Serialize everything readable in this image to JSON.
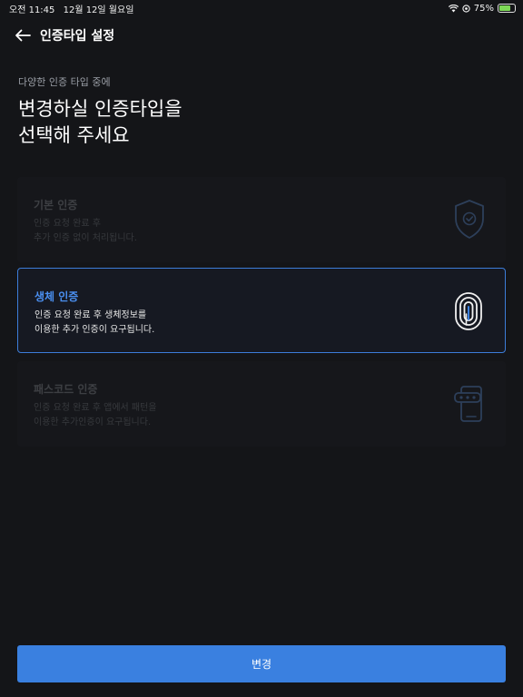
{
  "status_bar": {
    "time": "오전 11:45",
    "date": "12월 12일 월요일",
    "battery": "75%",
    "battery_level": 0.75
  },
  "header": {
    "title": "인증타입 설정"
  },
  "intro": {
    "subtitle": "다양한 인증 타입 중에",
    "title_line1": "변경하실 인증타입을",
    "title_line2": "선택해 주세요"
  },
  "options": [
    {
      "title": "기본 인증",
      "desc_line1": "인증 요청 완료 후",
      "desc_line2": "추가 인증 없이 처리됩니다.",
      "icon": "shield-check-icon",
      "state": "disabled"
    },
    {
      "title": "생체 인증",
      "desc_line1": "인증 요청 완료 후 생체정보를",
      "desc_line2": "이용한 추가 인증이 요구됩니다.",
      "icon": "fingerprint-icon",
      "state": "selected"
    },
    {
      "title": "패스코드 인증",
      "desc_line1": "인증 요청 완료 후 앱에서 패턴을",
      "desc_line2": "이용한 추가인증이 요구됩니다.",
      "icon": "phone-passcode-icon",
      "state": "disabled"
    }
  ],
  "submit": {
    "label": "변경"
  },
  "colors": {
    "background": "#141518",
    "accent": "#3a80e0",
    "selected_border": "#3c7dd9"
  }
}
